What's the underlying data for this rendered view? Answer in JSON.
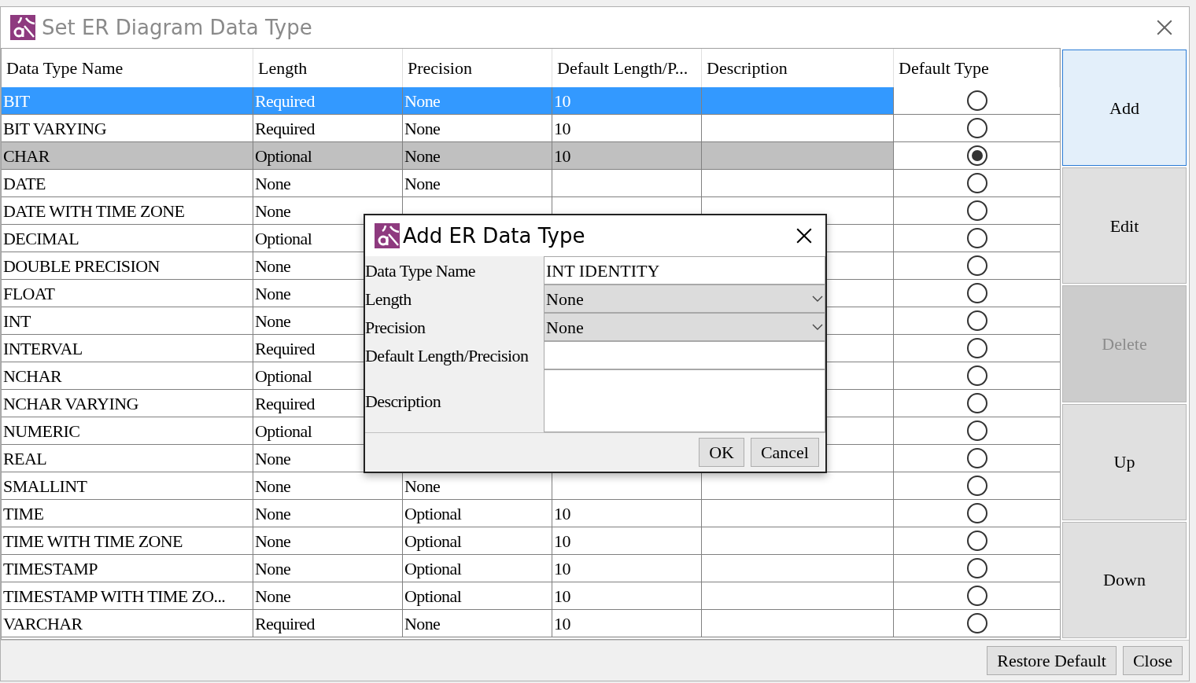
{
  "window": {
    "title": "Set ER Diagram Data Type"
  },
  "table": {
    "columns": [
      "Data Type Name",
      "Length",
      "Precision",
      "Default Length/P...",
      "Description",
      "Default Type"
    ],
    "rows": [
      {
        "name": "BIT",
        "length": "Required",
        "precision": "None",
        "default_length": "10",
        "selected": true,
        "default": false
      },
      {
        "name": "BIT VARYING",
        "length": "Required",
        "precision": "None",
        "default_length": "10",
        "selected": false,
        "default": false
      },
      {
        "name": "CHAR",
        "length": "Optional",
        "precision": "None",
        "default_length": "10",
        "selected": false,
        "default": true
      },
      {
        "name": "DATE",
        "length": "None",
        "precision": "None",
        "selected": false,
        "default": false
      },
      {
        "name": "DATE WITH TIME ZONE",
        "length": "None",
        "selected": false,
        "default": false
      },
      {
        "name": "DECIMAL",
        "length": "Optional",
        "selected": false,
        "default": false
      },
      {
        "name": "DOUBLE PRECISION",
        "length": "None",
        "selected": false,
        "default": false
      },
      {
        "name": "FLOAT",
        "length": "None",
        "selected": false,
        "default": false
      },
      {
        "name": "INT",
        "length": "None",
        "selected": false,
        "default": false
      },
      {
        "name": "INTERVAL",
        "length": "Required",
        "selected": false,
        "default": false
      },
      {
        "name": "NCHAR",
        "length": "Optional",
        "selected": false,
        "default": false
      },
      {
        "name": "NCHAR VARYING",
        "length": "Required",
        "selected": false,
        "default": false
      },
      {
        "name": "NUMERIC",
        "length": "Optional",
        "selected": false,
        "default": false
      },
      {
        "name": "REAL",
        "length": "None",
        "selected": false,
        "default": false
      },
      {
        "name": "SMALLINT",
        "length": "None",
        "precision": "None",
        "selected": false,
        "default": false
      },
      {
        "name": "TIME",
        "length": "None",
        "precision": "Optional",
        "default_length": "10",
        "selected": false,
        "default": false
      },
      {
        "name": "TIME WITH TIME ZONE",
        "length": "None",
        "precision": "Optional",
        "default_length": "10",
        "selected": false,
        "default": false
      },
      {
        "name": "TIMESTAMP",
        "length": "None",
        "precision": "Optional",
        "default_length": "10",
        "selected": false,
        "default": false
      },
      {
        "name": "TIMESTAMP WITH TIME ZO...",
        "length": "None",
        "precision": "Optional",
        "default_length": "10",
        "selected": false,
        "default": false
      },
      {
        "name": "VARCHAR",
        "length": "Required",
        "precision": "None",
        "default_length": "10",
        "selected": false,
        "default": false
      }
    ]
  },
  "side_buttons": [
    {
      "label": "Add",
      "focused": true,
      "disabled": false
    },
    {
      "label": "Edit",
      "focused": false,
      "disabled": false
    },
    {
      "label": "Delete",
      "focused": false,
      "disabled": true
    },
    {
      "label": "Up",
      "focused": false,
      "disabled": false
    },
    {
      "label": "Down",
      "focused": false,
      "disabled": false
    }
  ],
  "footer_buttons": [
    "Restore Default",
    "Close"
  ],
  "dialog": {
    "title": "Add ER Data Type",
    "fields": [
      {
        "kind": "text",
        "label": "Data Type Name",
        "value": "INT IDENTITY"
      },
      {
        "kind": "select",
        "label": "Length",
        "value": "None"
      },
      {
        "kind": "select",
        "label": "Precision",
        "value": "None"
      },
      {
        "kind": "text",
        "label": "Default Length/Precision"
      },
      {
        "kind": "textarea",
        "label": "Description"
      }
    ],
    "buttons": [
      "OK",
      "Cancel"
    ]
  }
}
